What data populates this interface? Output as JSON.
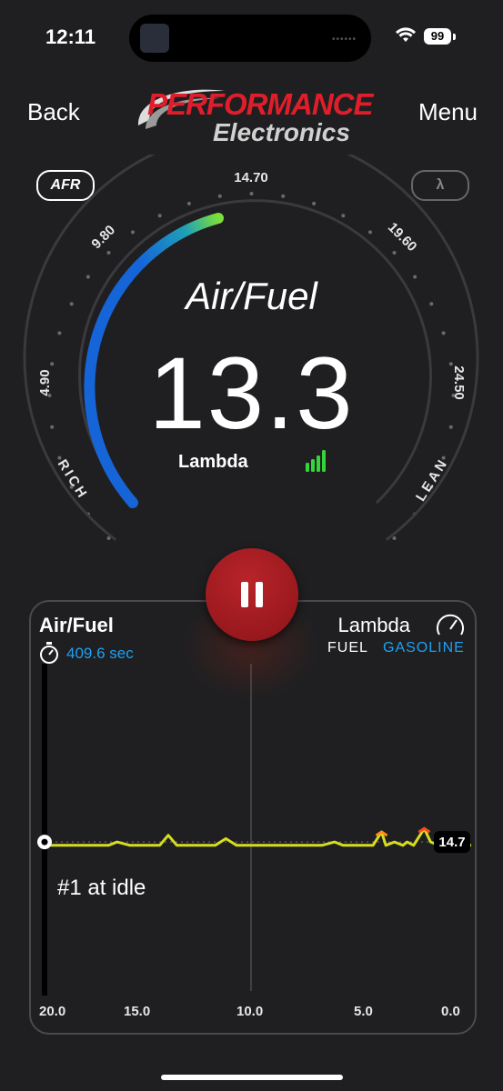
{
  "status_bar": {
    "time": "12:11",
    "battery": "99"
  },
  "header": {
    "back_label": "Back",
    "menu_label": "Menu",
    "logo_top": "PERFORMANCE",
    "logo_bottom": "Electronics"
  },
  "mode_pills": {
    "afr": "AFR",
    "lambda": "λ"
  },
  "gauge": {
    "title": "Air/Fuel",
    "value": "13.3",
    "lambda_label": "Lambda",
    "ticks": [
      "4.90",
      "9.80",
      "14.70",
      "19.60",
      "24.50"
    ],
    "left_label": "RICH",
    "right_label": "LEAN",
    "colors": {
      "arc": "#1565d8",
      "arc_tip": "#7be03a",
      "signal": "#35d43b"
    }
  },
  "chart_panel": {
    "title": "Air/Fuel",
    "timer": "409.6 sec",
    "mode": "Lambda",
    "fuel_label": "FUEL",
    "fuel_value": "GASOLINE",
    "current_badge": "14.7",
    "note": "#1 at idle",
    "x_ticks": [
      "20.0",
      "15.0",
      "10.0",
      "5.0",
      "0.0"
    ]
  },
  "chart_data": {
    "type": "line",
    "x_ticks": [
      "20.0",
      "15.0",
      "10.0",
      "5.0",
      "0.0"
    ],
    "xlim": [
      20.0,
      0.0
    ],
    "reference_value": 14.7,
    "series": [
      {
        "x": [
          20.0,
          19.0,
          18.0,
          17.0,
          16.6,
          16.0,
          15.5,
          14.6,
          14.2,
          13.8,
          13.0,
          12.0,
          11.5,
          11.0,
          10.0,
          9.0,
          8.2,
          8.0,
          7.0,
          6.4,
          6.0,
          5.5,
          5.0,
          4.6,
          4.2,
          4.0,
          3.6,
          3.2,
          3.0,
          2.7,
          2.2,
          1.9,
          1.5,
          1.0,
          0.5,
          0.0
        ],
        "values": [
          14.6,
          14.6,
          14.6,
          14.6,
          14.7,
          14.6,
          14.6,
          14.6,
          14.9,
          14.6,
          14.6,
          14.6,
          14.8,
          14.6,
          14.6,
          14.6,
          14.6,
          14.6,
          14.6,
          14.7,
          14.6,
          14.6,
          14.6,
          14.6,
          15.0,
          14.6,
          14.7,
          14.6,
          14.7,
          14.6,
          15.1,
          14.7,
          14.6,
          14.7,
          14.6,
          14.6
        ]
      }
    ]
  }
}
